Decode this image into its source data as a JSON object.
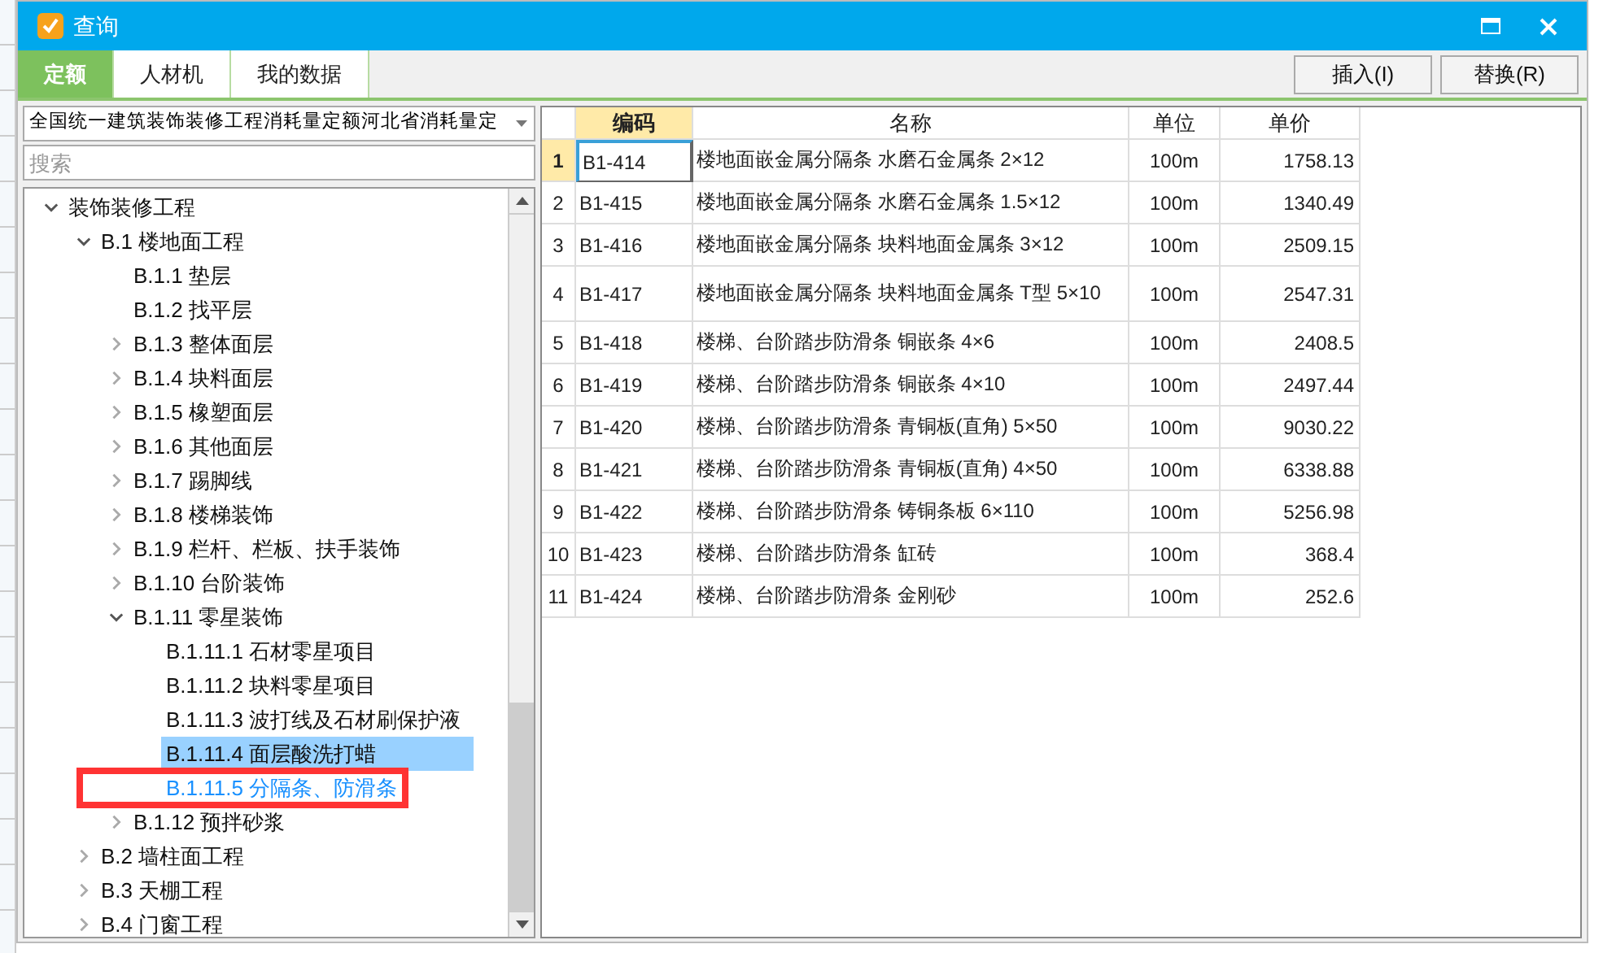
{
  "window": {
    "title": "查询"
  },
  "tabs": [
    {
      "label": "定额",
      "selected": true
    },
    {
      "label": "人材机",
      "selected": false
    },
    {
      "label": "我的数据",
      "selected": false
    }
  ],
  "buttons": [
    "插入(I)",
    "替换(R)"
  ],
  "library_select": {
    "value": "全国统一建筑装饰装修工程消耗量定额河北省消耗量定"
  },
  "search": {
    "placeholder": "搜索"
  },
  "tree": [
    {
      "label": "装饰装修工程",
      "expanded": true,
      "selected": false,
      "children": [
        {
          "label": "B.1 楼地面工程",
          "expanded": true,
          "selected": false,
          "children": [
            {
              "label": "B.1.1 垫层",
              "selected": false
            },
            {
              "label": "B.1.2 找平层",
              "selected": false
            },
            {
              "label": "B.1.3 整体面层",
              "expanded": false,
              "selected": false
            },
            {
              "label": "B.1.4 块料面层",
              "expanded": false,
              "selected": false
            },
            {
              "label": "B.1.5 橡塑面层",
              "expanded": false,
              "selected": false
            },
            {
              "label": "B.1.6 其他面层",
              "expanded": false,
              "selected": false
            },
            {
              "label": "B.1.7 踢脚线",
              "expanded": false,
              "selected": false
            },
            {
              "label": "B.1.8 楼梯装饰",
              "expanded": false,
              "selected": false
            },
            {
              "label": "B.1.9 栏杆、栏板、扶手装饰",
              "expanded": false,
              "selected": false
            },
            {
              "label": "B.1.10 台阶装饰",
              "expanded": false,
              "selected": false
            },
            {
              "label": "B.1.11 零星装饰",
              "expanded": true,
              "selected": false,
              "children": [
                {
                  "label": "B.1.11.1 石材零星项目",
                  "selected": false,
                  "hovered": false
                },
                {
                  "label": "B.1.11.2 块料零星项目",
                  "selected": false,
                  "hovered": false
                },
                {
                  "label": "B.1.11.3 波打线及石材刷保护液",
                  "selected": false,
                  "hovered": false
                },
                {
                  "label": "B.1.11.4 面层酸洗打蜡",
                  "selected": true,
                  "hovered": false
                },
                {
                  "label": "B.1.11.5 分隔条、防滑条",
                  "selected": false,
                  "hovered": true
                }
              ]
            },
            {
              "label": "B.1.12 预拌砂浆",
              "expanded": false,
              "selected": false
            }
          ]
        },
        {
          "label": "B.2 墙柱面工程",
          "expanded": false,
          "selected": false
        },
        {
          "label": "B.3 天棚工程",
          "expanded": false,
          "selected": false
        },
        {
          "label": "B.4 门窗工程",
          "expanded": false,
          "selected": false
        }
      ]
    }
  ],
  "table": {
    "columns": [
      "编码",
      "名称",
      "单位",
      "单价"
    ],
    "rows": [
      {
        "no": "1",
        "code": "B1-414",
        "name": "楼地面嵌金属分隔条 水磨石金属条 2×12",
        "unit": "100m",
        "price": "1758.13",
        "selected": true
      },
      {
        "no": "2",
        "code": "B1-415",
        "name": "楼地面嵌金属分隔条 水磨石金属条 1.5×12",
        "unit": "100m",
        "price": "1340.49",
        "selected": false
      },
      {
        "no": "3",
        "code": "B1-416",
        "name": "楼地面嵌金属分隔条 块料地面金属条 3×12",
        "unit": "100m",
        "price": "2509.15",
        "selected": false
      },
      {
        "no": "4",
        "code": "B1-417",
        "name": "楼地面嵌金属分隔条 块料地面金属条 T型 5×10",
        "unit": "100m",
        "price": "2547.31",
        "selected": false
      },
      {
        "no": "5",
        "code": "B1-418",
        "name": "楼梯、台阶踏步防滑条 铜嵌条 4×6",
        "unit": "100m",
        "price": "2408.5",
        "selected": false
      },
      {
        "no": "6",
        "code": "B1-419",
        "name": "楼梯、台阶踏步防滑条 铜嵌条 4×10",
        "unit": "100m",
        "price": "2497.44",
        "selected": false
      },
      {
        "no": "7",
        "code": "B1-420",
        "name": "楼梯、台阶踏步防滑条 青铜板(直角) 5×50",
        "unit": "100m",
        "price": "9030.22",
        "selected": false
      },
      {
        "no": "8",
        "code": "B1-421",
        "name": "楼梯、台阶踏步防滑条 青铜板(直角) 4×50",
        "unit": "100m",
        "price": "6338.88",
        "selected": false
      },
      {
        "no": "9",
        "code": "B1-422",
        "name": "楼梯、台阶踏步防滑条 铸铜条板 6×110",
        "unit": "100m",
        "price": "5256.98",
        "selected": false
      },
      {
        "no": "10",
        "code": "B1-423",
        "name": "楼梯、台阶踏步防滑条 缸砖",
        "unit": "100m",
        "price": "368.4",
        "selected": false
      },
      {
        "no": "11",
        "code": "B1-424",
        "name": "楼梯、台阶踏步防滑条 金刚砂",
        "unit": "100m",
        "price": "252.6",
        "selected": false
      }
    ]
  }
}
